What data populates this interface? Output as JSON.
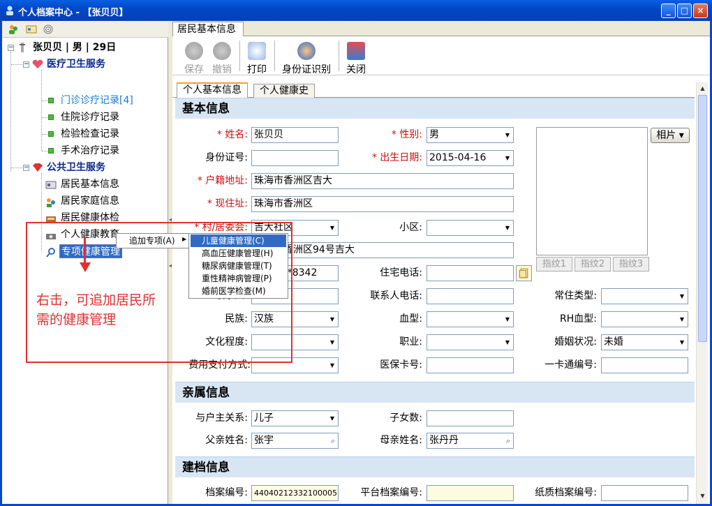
{
  "window": {
    "title": "个人档案中心 - 【张贝贝】",
    "min": "_",
    "max": "□",
    "close": "×"
  },
  "doc_tab": "居民基本信息",
  "tree": {
    "root": "张贝贝 | 男 | 29日",
    "medical": "医疗卫生服务",
    "medical_items": [
      "门诊诊疗记录[4]",
      "住院诊疗记录",
      "检验检查记录",
      "手术治疗记录"
    ],
    "public": "公共卫生服务",
    "public_items": [
      "居民基本信息",
      "居民家庭信息",
      "居民健康体检",
      "个人健康教育",
      "专项健康管理"
    ]
  },
  "toolbar": {
    "save": "保存",
    "cancel": "撤销",
    "print": "打印",
    "idcard": "身份证识别",
    "close": "关闭"
  },
  "context_menu": {
    "item": "追加专项(A)",
    "submenu": [
      "儿童健康管理(C)",
      "高血压健康管理(H)",
      "糖尿病健康管理(T)",
      "重性精神病管理(P)",
      "婚前医学检查(M)"
    ]
  },
  "annotation": "右击，可追加居民所需的健康管理",
  "tabs": [
    "个人基本信息",
    "个人健康史"
  ],
  "sections": {
    "basic": "基本信息",
    "relatives": "亲属信息",
    "archive": "建档信息"
  },
  "star": "*",
  "form": {
    "name_label": "姓名:",
    "name": "张贝贝",
    "gender_label": "性别:",
    "gender": "男",
    "id_label": "身份证号:",
    "id": "",
    "dob_label": "出生日期:",
    "dob": "2015-04-16",
    "hukou_label": "户籍地址:",
    "hukou": "珠海市香洲区吉大",
    "addr_label": "现住址:",
    "addr": "珠海市香洲区",
    "village_label": "村/居委会:",
    "village": "吉大社区",
    "community_label": "小区:",
    "community": "",
    "detail_addr": "珠海市香洲区94号吉大",
    "phone_label": "住宅电话:",
    "mobile": "139****8342",
    "phone": "",
    "contact_label": "联系人电话:",
    "contact": "",
    "workunit_label": "联系人:",
    "residence_label": "常住类型:",
    "residence": "",
    "ethnic_label": "民族:",
    "ethnic": "汉族",
    "blood_label": "血型:",
    "blood": "",
    "rh_label": "RH血型:",
    "rh": "",
    "edu_label": "文化程度:",
    "edu": "",
    "job_label": "职业:",
    "job": "",
    "marital_label": "婚姻状况:",
    "marital": "未婚",
    "pay_label": "费用支付方式:",
    "pay": "",
    "insure_label": "医保卡号:",
    "insure": "",
    "card_label": "一卡通编号:",
    "card": "",
    "relation_label": "与户主关系:",
    "relation": "儿子",
    "children_label": "子女数:",
    "children": "",
    "father_label": "父亲姓名:",
    "father": "张宇",
    "mother_label": "母亲姓名:",
    "mother": "张丹丹",
    "archive_no_label": "档案编号:",
    "archive_no": "44040212332100005",
    "platform_label": "平台档案编号:",
    "platform": "",
    "paper_label": "纸质档案编号:",
    "paper": ""
  },
  "photo": {
    "button": "相片 ▾",
    "fp": [
      "指纹1",
      "指纹2",
      "指纹3"
    ]
  },
  "colors": {
    "titlebar": "#0148c8",
    "section": "#d8e6f4",
    "required": "#c81010",
    "annotation": "#e03030",
    "menu_highlight": "#316ac5"
  }
}
